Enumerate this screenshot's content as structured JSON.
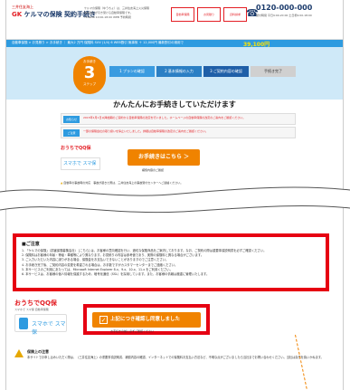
{
  "header": {
    "logo_small": "三井住友海上",
    "logo_name": "ケルマの保険 契約手続き",
    "info_line1": "ケルマの保険（ゆうちょ）は、三井住友海上火災保険",
    "info_line2": "株式会社が引き受ける自動車保険です。",
    "info_hours": "TimeDB 10:00-18:00 WEB 予約時間",
    "box1": "自動車保険",
    "box2": "お見積り",
    "box3": "資料請求",
    "phone": "0120-000-000",
    "phone_sub": "受付時間 平日9:00-20:00 土日祝9:00-18:00"
  },
  "nav": {
    "text": "自動車保険 > お見積り > お手続き ｜ 最大2 万円 保険料 SUV (1/4) 6 WEB割引 無事故 ＋ 12,000円 最新割引の適用で",
    "yen": "39,100円"
  },
  "steps": {
    "circle_top": "お手続き",
    "circle_num": "3",
    "circle_bottom": "ステップ",
    "bars": [
      "1 プランの確認",
      "2 基本情報の入力",
      "3 ご契約内容の確認",
      "手続き完了"
    ]
  },
  "intro_title": "かんたんにお手続きしていただけます",
  "notices": [
    {
      "tag": "お知らせ",
      "text": "2015年1月1日以降始期のご契約から自動車保険の改定を行いました。ホームページの自動車保険の改定のご案内をご確認ください。"
    },
    {
      "tag": "ご注意",
      "text": "一部の保険会社の取り扱いを停止いたしました。詳細は自動車保険の改定のご案内をご確認ください。"
    }
  ],
  "mini": {
    "logo": "おうちでQQ保",
    "phone_label": "スマホで スマ保",
    "orange_btn": "お手続きはこちら ＞",
    "orange_sub": "補償内容のご確認",
    "alert": "自動車の事故時の対応　事故が起きた際は、三井住友海上の事故受付センターへご連絡ください。"
  },
  "notes": {
    "title": "■ご注意",
    "lines": [
      "1. 「ケルマの保険」（損害保険募集会社） [こちら] は、お客様の意向確認を行い、適切な保険商品をご案内しております。なお、ご契約の際は重要事項説明書を必ずご確認ください。",
      "2. 保険料はお客様の年齢・等級・車種等により異なります。お見積りの内容は参考値であり、実際の保険料と異なる場合がございます。",
      "3. ご入力いただいた内容に誤りがある場合、保険金をお支払いできないことがありますのでご注意ください。",
      "4. お手続き完了後、ご契約内容の変更を希望される場合は、お手数ですがカスタマーセンターまでご連絡ください。",
      "5. 本サービスのご利用にあたっては、Microsoft Internet Explorer 8.x、9.x、10.x、11.x をご利用ください。",
      "6. 本サービスは、お客様の個人情報を保護するため、暗号化通信（SSL）を採用しています。また、お客様の情報は厳重に管理いたします。"
    ],
    "link": "こちら"
  },
  "bottom": {
    "logo": "おうちでQQ保",
    "logo_sub": "スマホで スマ保 自動車保険",
    "phone_label": "スマホで スマ保",
    "confirm_btn": "上記につき確認し同意しました",
    "confirm_sub": "お手続きの前に必ずご確認ください",
    "warn_title": "保険上の注意",
    "warn_text": "本サイトでお申し込みいただく際は、（三井住友海上）の重要事項説明書、補償内容の確認、インターネットでの保険料お支払い方法など、不明な点がございましたら当社までお問い合わせください。当社は責任を負いかねます。"
  },
  "colors": {
    "accent_orange": "#f08300",
    "highlight_red": "#e60012",
    "brand_blue": "#2e9be0"
  }
}
